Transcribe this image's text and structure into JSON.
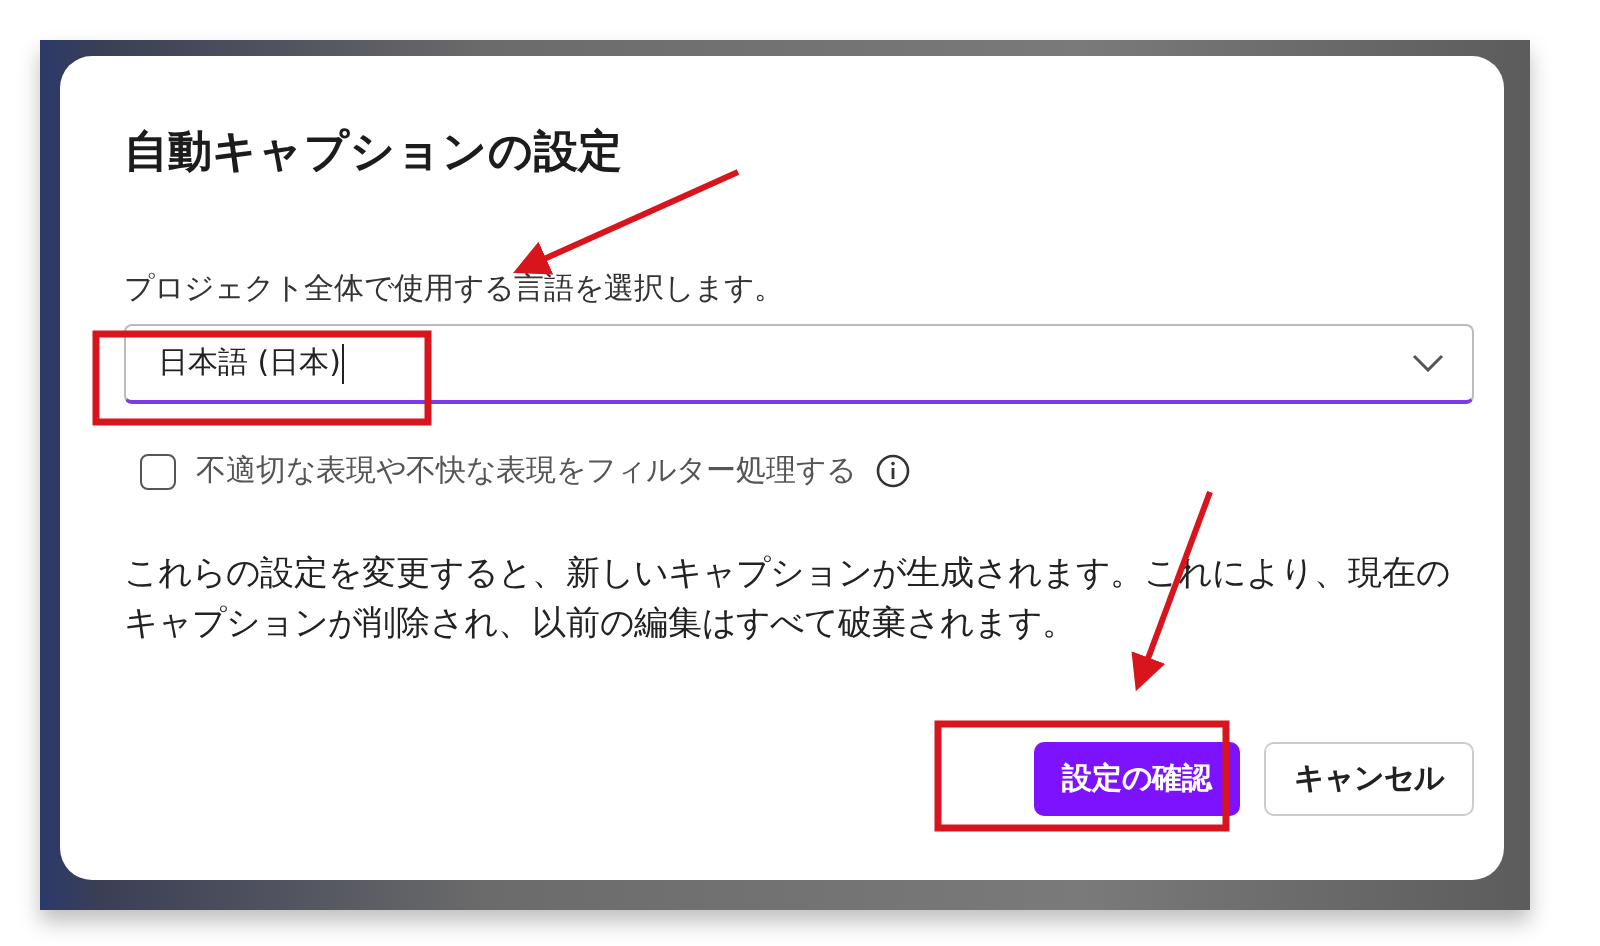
{
  "dialog": {
    "title": "自動キャプションの設定",
    "language": {
      "label": "プロジェクト全体で使用する言語を選択します。",
      "value": "日本語 (日本)"
    },
    "filter": {
      "label": "不適切な表現や不快な表現をフィルター処理する",
      "checked": false
    },
    "notice": "これらの設定を変更すると、新しいキャプションが生成されます。これにより、現在のキャプションが削除され、以前の編集はすべて破棄されます。",
    "buttons": [
      {
        "label": "設定の確認",
        "kind": "primary"
      },
      {
        "label": "キャンセル",
        "kind": "secondary"
      }
    ]
  }
}
